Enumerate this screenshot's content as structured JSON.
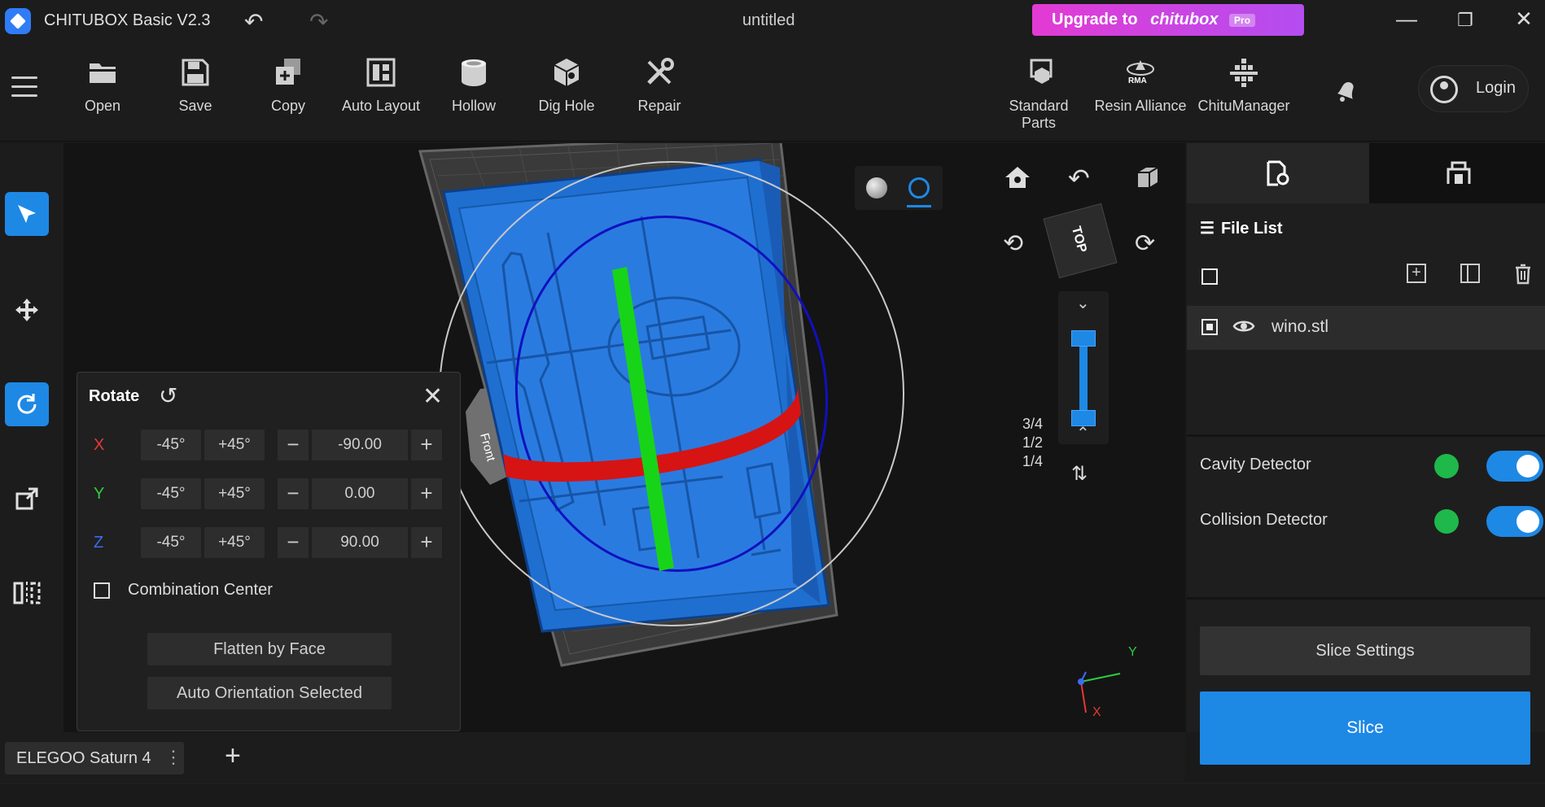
{
  "titlebar": {
    "app_title": "CHITUBOX Basic V2.3",
    "doc_title": "untitled",
    "upgrade_text": "Upgrade to",
    "upgrade_brand": "chitubox",
    "upgrade_badge": "Pro"
  },
  "toolbar": {
    "tools": [
      {
        "label": "Open",
        "icon": "folder-icon"
      },
      {
        "label": "Save",
        "icon": "save-icon"
      },
      {
        "label": "Copy",
        "icon": "copy-icon"
      },
      {
        "label": "Auto Layout",
        "icon": "auto-layout-icon"
      },
      {
        "label": "Hollow",
        "icon": "hollow-icon"
      },
      {
        "label": "Dig Hole",
        "icon": "dig-hole-icon"
      },
      {
        "label": "Repair",
        "icon": "repair-icon"
      }
    ],
    "right_tools": [
      {
        "label": "Standard Parts",
        "icon": "standard-parts-icon"
      },
      {
        "label": "Resin Alliance",
        "icon": "resin-alliance-icon"
      },
      {
        "label": "ChituManager",
        "icon": "chitumanager-icon"
      }
    ],
    "resin_alliance_badge": "RMA",
    "login_label": "Login"
  },
  "rotate_panel": {
    "title": "Rotate",
    "axes": [
      {
        "axis": "X",
        "minus_label": "-45°",
        "plus_label": "+45°",
        "value": "-90.00",
        "color": "#e53935"
      },
      {
        "axis": "Y",
        "minus_label": "-45°",
        "plus_label": "+45°",
        "value": "0.00",
        "color": "#2ecc40"
      },
      {
        "axis": "Z",
        "minus_label": "-45°",
        "plus_label": "+45°",
        "value": "90.00",
        "color": "#3b6cf5"
      }
    ],
    "combination_center_label": "Combination Center",
    "flatten_label": "Flatten by Face",
    "auto_orient_label": "Auto Orientation Selected"
  },
  "viewport": {
    "front_label": "Front",
    "cube_label": "TOP",
    "slider_fractions": [
      "3/4",
      "1/2",
      "1/4"
    ],
    "axis_y_label": "Y",
    "axis_x_label": "X"
  },
  "right_panel": {
    "file_list_title": "File List",
    "files": [
      {
        "name": "wino.stl"
      }
    ],
    "detectors": [
      {
        "label": "Cavity Detector",
        "enabled": true
      },
      {
        "label": "Collision Detector",
        "enabled": true
      }
    ],
    "slice_settings_label": "Slice Settings",
    "slice_label": "Slice"
  },
  "bottombar": {
    "printer_name": "ELEGOO Saturn 4",
    "add_symbol": "+"
  },
  "colors": {
    "accent": "#1e88e5",
    "upgrade_gradient_start": "#e23bd3",
    "model_blue": "#1f6fd1",
    "ring_red": "#d61414",
    "ring_green": "#18d418",
    "ring_blue": "#1010c0"
  }
}
